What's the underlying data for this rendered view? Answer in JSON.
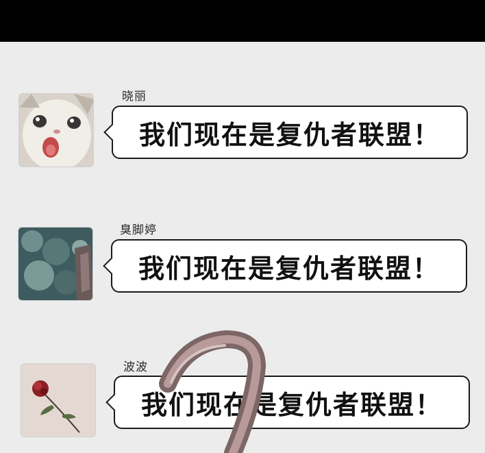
{
  "messages": [
    {
      "sender": "晓丽",
      "text": "我们现在是复仇者联盟！",
      "avatar": "cat-avatar"
    },
    {
      "sender": "臭脚婷",
      "text": "我们现在是复仇者联盟！",
      "avatar": "ocean-avatar"
    },
    {
      "sender": "波波",
      "text": "我们现在是复仇者联盟！",
      "avatar": "rose-avatar"
    }
  ],
  "colors": {
    "background": "#ececec",
    "top_bar": "#000000",
    "bubble_border": "#1a1a1a",
    "hook": "#8a6f6f"
  }
}
